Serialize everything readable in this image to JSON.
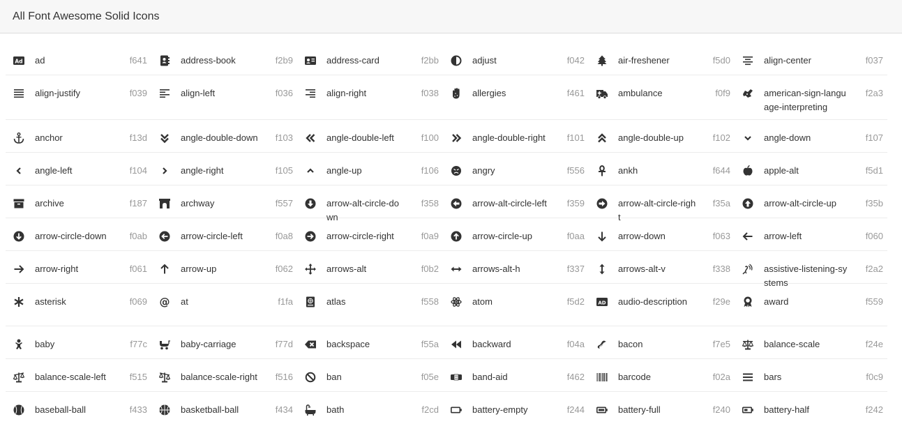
{
  "header": {
    "title": "All Font Awesome Solid Icons"
  },
  "icons": [
    {
      "name": "ad",
      "code": "f641",
      "icon": "ad-icon"
    },
    {
      "name": "address-book",
      "code": "f2b9",
      "icon": "address-book-icon"
    },
    {
      "name": "address-card",
      "code": "f2bb",
      "icon": "address-card-icon"
    },
    {
      "name": "adjust",
      "code": "f042",
      "icon": "adjust-icon"
    },
    {
      "name": "air-freshener",
      "code": "f5d0",
      "icon": "air-freshener-icon"
    },
    {
      "name": "align-center",
      "code": "f037",
      "icon": "align-center-icon"
    },
    {
      "name": "align-justify",
      "code": "f039",
      "icon": "align-justify-icon"
    },
    {
      "name": "align-left",
      "code": "f036",
      "icon": "align-left-icon"
    },
    {
      "name": "align-right",
      "code": "f038",
      "icon": "align-right-icon"
    },
    {
      "name": "allergies",
      "code": "f461",
      "icon": "allergies-icon"
    },
    {
      "name": "ambulance",
      "code": "f0f9",
      "icon": "ambulance-icon"
    },
    {
      "name": "american-sign-language-interpreting",
      "code": "f2a3",
      "icon": "american-sign-language-interpreting-icon"
    },
    {
      "name": "anchor",
      "code": "f13d",
      "icon": "anchor-icon"
    },
    {
      "name": "angle-double-down",
      "code": "f103",
      "icon": "angle-double-down-icon"
    },
    {
      "name": "angle-double-left",
      "code": "f100",
      "icon": "angle-double-left-icon"
    },
    {
      "name": "angle-double-right",
      "code": "f101",
      "icon": "angle-double-right-icon"
    },
    {
      "name": "angle-double-up",
      "code": "f102",
      "icon": "angle-double-up-icon"
    },
    {
      "name": "angle-down",
      "code": "f107",
      "icon": "angle-down-icon"
    },
    {
      "name": "angle-left",
      "code": "f104",
      "icon": "angle-left-icon"
    },
    {
      "name": "angle-right",
      "code": "f105",
      "icon": "angle-right-icon"
    },
    {
      "name": "angle-up",
      "code": "f106",
      "icon": "angle-up-icon"
    },
    {
      "name": "angry",
      "code": "f556",
      "icon": "angry-icon"
    },
    {
      "name": "ankh",
      "code": "f644",
      "icon": "ankh-icon"
    },
    {
      "name": "apple-alt",
      "code": "f5d1",
      "icon": "apple-alt-icon"
    },
    {
      "name": "archive",
      "code": "f187",
      "icon": "archive-icon"
    },
    {
      "name": "archway",
      "code": "f557",
      "icon": "archway-icon"
    },
    {
      "name": "arrow-alt-circle-down",
      "code": "f358",
      "icon": "arrow-alt-circle-down-icon"
    },
    {
      "name": "arrow-alt-circle-left",
      "code": "f359",
      "icon": "arrow-alt-circle-left-icon"
    },
    {
      "name": "arrow-alt-circle-right",
      "code": "f35a",
      "icon": "arrow-alt-circle-right-icon"
    },
    {
      "name": "arrow-alt-circle-up",
      "code": "f35b",
      "icon": "arrow-alt-circle-up-icon"
    },
    {
      "name": "arrow-circle-down",
      "code": "f0ab",
      "icon": "arrow-circle-down-icon"
    },
    {
      "name": "arrow-circle-left",
      "code": "f0a8",
      "icon": "arrow-circle-left-icon"
    },
    {
      "name": "arrow-circle-right",
      "code": "f0a9",
      "icon": "arrow-circle-right-icon"
    },
    {
      "name": "arrow-circle-up",
      "code": "f0aa",
      "icon": "arrow-circle-up-icon"
    },
    {
      "name": "arrow-down",
      "code": "f063",
      "icon": "arrow-down-icon"
    },
    {
      "name": "arrow-left",
      "code": "f060",
      "icon": "arrow-left-icon"
    },
    {
      "name": "arrow-right",
      "code": "f061",
      "icon": "arrow-right-icon"
    },
    {
      "name": "arrow-up",
      "code": "f062",
      "icon": "arrow-up-icon"
    },
    {
      "name": "arrows-alt",
      "code": "f0b2",
      "icon": "arrows-alt-icon"
    },
    {
      "name": "arrows-alt-h",
      "code": "f337",
      "icon": "arrows-alt-h-icon"
    },
    {
      "name": "arrows-alt-v",
      "code": "f338",
      "icon": "arrows-alt-v-icon"
    },
    {
      "name": "assistive-listening-systems",
      "code": "f2a2",
      "icon": "assistive-listening-systems-icon"
    },
    {
      "name": "asterisk",
      "code": "f069",
      "icon": "asterisk-icon"
    },
    {
      "name": "at",
      "code": "f1fa",
      "icon": "at-icon"
    },
    {
      "name": "atlas",
      "code": "f558",
      "icon": "atlas-icon"
    },
    {
      "name": "atom",
      "code": "f5d2",
      "icon": "atom-icon"
    },
    {
      "name": "audio-description",
      "code": "f29e",
      "icon": "audio-description-icon"
    },
    {
      "name": "award",
      "code": "f559",
      "icon": "award-icon"
    },
    {
      "name": "baby",
      "code": "f77c",
      "icon": "baby-icon"
    },
    {
      "name": "baby-carriage",
      "code": "f77d",
      "icon": "baby-carriage-icon"
    },
    {
      "name": "backspace",
      "code": "f55a",
      "icon": "backspace-icon"
    },
    {
      "name": "backward",
      "code": "f04a",
      "icon": "backward-icon"
    },
    {
      "name": "bacon",
      "code": "f7e5",
      "icon": "bacon-icon"
    },
    {
      "name": "balance-scale",
      "code": "f24e",
      "icon": "balance-scale-icon"
    },
    {
      "name": "balance-scale-left",
      "code": "f515",
      "icon": "balance-scale-left-icon"
    },
    {
      "name": "balance-scale-right",
      "code": "f516",
      "icon": "balance-scale-right-icon"
    },
    {
      "name": "ban",
      "code": "f05e",
      "icon": "ban-icon"
    },
    {
      "name": "band-aid",
      "code": "f462",
      "icon": "band-aid-icon"
    },
    {
      "name": "barcode",
      "code": "f02a",
      "icon": "barcode-icon"
    },
    {
      "name": "bars",
      "code": "f0c9",
      "icon": "bars-icon"
    },
    {
      "name": "baseball-ball",
      "code": "f433",
      "icon": "baseball-ball-icon"
    },
    {
      "name": "basketball-ball",
      "code": "f434",
      "icon": "basketball-ball-icon"
    },
    {
      "name": "bath",
      "code": "f2cd",
      "icon": "bath-icon"
    },
    {
      "name": "battery-empty",
      "code": "f244",
      "icon": "battery-empty-icon"
    },
    {
      "name": "battery-full",
      "code": "f240",
      "icon": "battery-full-icon"
    },
    {
      "name": "battery-half",
      "code": "f242",
      "icon": "battery-half-icon"
    }
  ]
}
